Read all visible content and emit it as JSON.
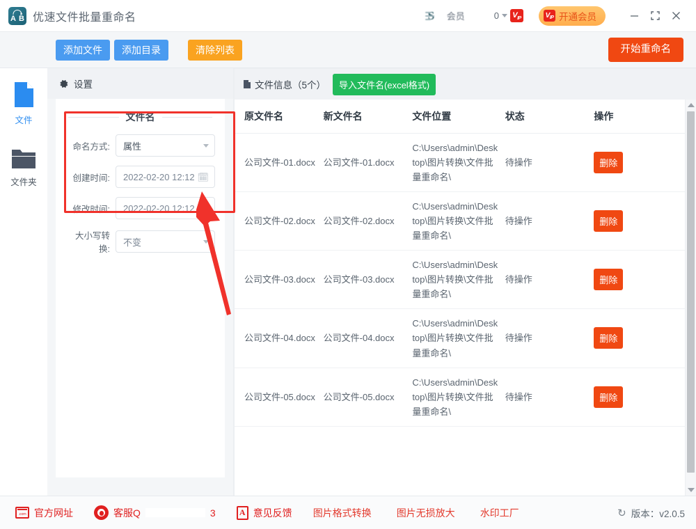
{
  "titlebar": {
    "app_title": "优速文件批量重命名",
    "logo_letters": [
      "A",
      "B"
    ],
    "user_name": "会员",
    "credit_value": "0",
    "vip_badge_text": "VIP",
    "vip_button_label": "开通会员",
    "minimize_icon": "minimize-icon",
    "maximize_icon": "maximize-icon",
    "close_icon": "close-icon"
  },
  "toolbar": {
    "add_file_label": "添加文件",
    "add_dir_label": "添加目录",
    "clear_list_label": "清除列表",
    "start_rename_label": "开始重命名",
    "colors": {
      "blue": "#4a9bf0",
      "orange": "#faa320",
      "red": "#f04812",
      "green": "#22bb5b"
    }
  },
  "sidebar": {
    "items": [
      {
        "label": "文件",
        "icon": "file-icon",
        "active": true
      },
      {
        "label": "文件夹",
        "icon": "folder-icon",
        "active": false
      }
    ]
  },
  "settings": {
    "header_title": "设置",
    "header_icon": "gear-icon",
    "section_title": "文件名",
    "fields": [
      {
        "label": "命名方式:",
        "value": "属性",
        "control": "select"
      },
      {
        "label": "创建时间:",
        "value": "2022-02-20 12:12",
        "control": "datepicker"
      },
      {
        "label": "修改时间:",
        "value": "2022-02-20 12:12",
        "control": "datepicker"
      },
      {
        "label": "大小写转换:",
        "value": "不变",
        "control": "select"
      }
    ]
  },
  "annotation": {
    "box_color": "#f0322b",
    "arrow_color": "#f0322b"
  },
  "filelist": {
    "header_title": "文件信息（5个）",
    "header_icon": "file-info-icon",
    "import_button_label": "导入文件名(excel格式)",
    "columns": [
      "原文件名",
      "新文件名",
      "文件位置",
      "状态",
      "操作"
    ],
    "rows": [
      {
        "original": "公司文件-01.docx",
        "new": "公司文件-01.docx",
        "path": "C:\\Users\\admin\\Desktop\\图片转换\\文件批量重命名\\",
        "status": "待操作",
        "action": "删除"
      },
      {
        "original": "公司文件-02.docx",
        "new": "公司文件-02.docx",
        "path": "C:\\Users\\admin\\Desktop\\图片转换\\文件批量重命名\\",
        "status": "待操作",
        "action": "删除"
      },
      {
        "original": "公司文件-03.docx",
        "new": "公司文件-03.docx",
        "path": "C:\\Users\\admin\\Desktop\\图片转换\\文件批量重命名\\",
        "status": "待操作",
        "action": "删除"
      },
      {
        "original": "公司文件-04.docx",
        "new": "公司文件-04.docx",
        "path": "C:\\Users\\admin\\Desktop\\图片转换\\文件批量重命名\\",
        "status": "待操作",
        "action": "删除"
      },
      {
        "original": "公司文件-05.docx",
        "new": "公司文件-05.docx",
        "path": "C:\\Users\\admin\\Desktop\\图片转换\\文件批量重命名\\",
        "status": "待操作",
        "action": "删除"
      }
    ]
  },
  "footer": {
    "website_label": "官方网址",
    "website_icon": "com-icon",
    "support_label": "客服Q",
    "support_suffix": "3",
    "support_icon": "headset-icon",
    "feedback_label": "意见反馈",
    "feedback_icon": "feedback-icon",
    "links": [
      "图片格式转换",
      "图片无损放大",
      "水印工厂"
    ],
    "version_label": "版本：v2.0.5",
    "version_icon": "refresh-icon"
  }
}
